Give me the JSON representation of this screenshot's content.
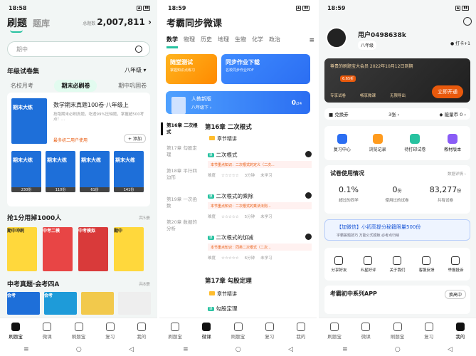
{
  "s1": {
    "time": "18:58",
    "tab1": "刷题",
    "tab2": "题库",
    "total_label": "总题数",
    "total": "2,007,811",
    "search_placeholder": "期中",
    "sec1": "年级试卷集",
    "grade": "八年级",
    "subtabs": [
      "名校月考",
      "期末必刷卷",
      "期中巩固卷"
    ],
    "card_title": "数学期末真题100卷·八年级上",
    "card_desc": "抢跑期末必刷真题，吃透99%压轴题，掌握超500考点！...",
    "card_buy": "最多初二用户使用",
    "card_add": "添加",
    "book_title": "期末大练",
    "book_counts": [
      "230份",
      "110份",
      "61份",
      "141份"
    ],
    "sec2": "抢1分用掉1000人",
    "sec2_right": "共5册",
    "sec2_books": [
      "期中冲刺",
      "中考二模",
      "中考模拟",
      "期中"
    ],
    "sec3": "中考真题·会考四A",
    "sec3_right": "共8册",
    "sec3_books": [
      "会考",
      "会考"
    ],
    "tabs": [
      "刷题宝",
      "微课",
      "刷题宝",
      "复习",
      "我的"
    ]
  },
  "s2": {
    "time": "18:59",
    "title": "考霸同步微课",
    "subjects": [
      "数学",
      "物理",
      "历史",
      "地理",
      "生物",
      "化学",
      "政治"
    ],
    "b1_t": "随堂测试",
    "b1_s": "掌握知识点练习",
    "b2_t": "同步作业下载",
    "b2_s": "名校同步作业PDF",
    "book_ed": "人教新版",
    "book_gr": "八年级下",
    "progress": "0",
    "progress_total": "/24",
    "side": [
      "第16章 二次根式",
      "第17章 勾股定理",
      "第18章 平行四边形",
      "第19章 一次函数",
      "第20章 数据的分析"
    ],
    "ch1": "第16章 二次根式",
    "hl1": "章节精讲",
    "items": [
      {
        "t": "二次根式",
        "k": "本节重点知识：二次根式的定义（二次...",
        "d": [
          "难度",
          "☆☆☆☆☆",
          "3分钟",
          "未学习"
        ]
      },
      {
        "t": "二次根式的乘除",
        "k": "本节重点知识：二次根式的乘法法则...",
        "d": [
          "难度",
          "☆☆☆☆☆",
          "5分钟",
          "未学习"
        ]
      },
      {
        "t": "二次根式的加减",
        "k": "本节重点知识：同类二次根式（二次...",
        "d": [
          "难度",
          "☆☆☆☆☆",
          "6分钟",
          "未学习"
        ]
      }
    ],
    "ch2": "第17章 勾股定理",
    "hl2": "章节精讲",
    "item4": "勾股定理",
    "tabs": [
      "刷题宝",
      "微课",
      "刷题宝",
      "复习",
      "我的"
    ]
  },
  "s3": {
    "time": "18:59",
    "name": "用户0498638k",
    "grade": "八年级",
    "checkin": "打卡+1",
    "vip_title": "尊贵的刷题宝大会员 2022年10月12日到期",
    "vip_tag": "6.65折",
    "vip_feats": [
      "专享试卷",
      "畅享微课",
      "无限导出"
    ],
    "vip_btn": "立即开通",
    "vfoot_l": "兑换券",
    "vfoot_m": "3张",
    "vfoot_r": "能量币 0",
    "fn": [
      "复习中心",
      "浏览记录",
      "待打印试卷",
      "教材版本"
    ],
    "stats_h": "试卷使用情况",
    "stats_r": "数据详情",
    "stats": [
      {
        "v": "0.1%",
        "u": "",
        "l": "超过的同学"
      },
      {
        "v": "0",
        "u": "份",
        "l": "使用过的试卷"
      },
      {
        "v": "83,277",
        "u": "份",
        "l": "共有试卷"
      }
    ],
    "wx_t": "【加微信】小初高提分秘籍限量500份",
    "wx_s": "字霸答题技巧 万能公式模板 必考点归纳",
    "icons": [
      "分享好友",
      "五星好评",
      "关于我们",
      "客服反馈",
      "举报投诉"
    ],
    "app_t": "考霸初中系列APP",
    "app_b": "换高中",
    "tabs": [
      "刷题宝",
      "微课",
      "刷题宝",
      "复习",
      "我的"
    ]
  }
}
